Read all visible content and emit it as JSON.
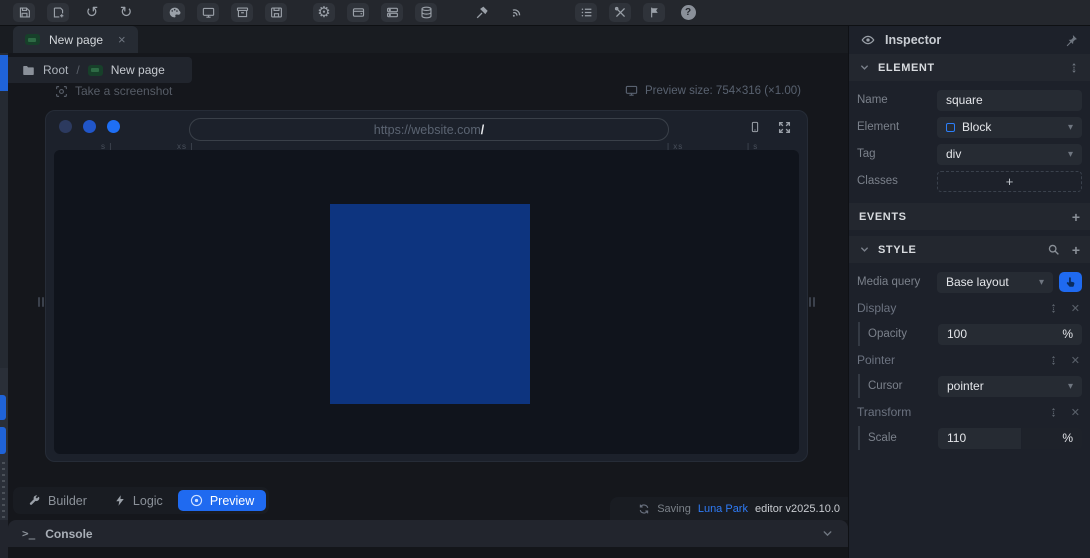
{
  "toolbar": {
    "icons": [
      "save",
      "save-add",
      "undo",
      "redo",
      "palette",
      "monitor",
      "archive",
      "drive",
      "settings",
      "wallet",
      "server",
      "database",
      "hammer",
      "signal",
      "list",
      "tools",
      "flag",
      "help"
    ],
    "undo_glyph": "↺",
    "redo_glyph": "↻",
    "gear_glyph": "⚙",
    "help_glyph": "?"
  },
  "tab": {
    "label": "New page",
    "close_glyph": "×"
  },
  "breadcrumb": {
    "root": "Root",
    "separator": "/",
    "current": "New page"
  },
  "actions": {
    "take_screenshot": "Take a screenshot"
  },
  "preview": {
    "size_label": "Preview size: 754×316 (×1.00)",
    "url": "https://website.com",
    "url_cursor": "/",
    "bp_left_s": "s |",
    "bp_left_xs": "xs |",
    "bp_right_xs": "| xs",
    "bp_right_s": "| s"
  },
  "mode_tabs": {
    "builder": "Builder",
    "logic": "Logic",
    "preview": "Preview"
  },
  "statusbar": {
    "saving": "Saving",
    "brand": "Luna Park",
    "version": "editor v2025.10.0"
  },
  "console": {
    "label": "Console",
    "prompt_glyph": ">_"
  },
  "inspector": {
    "title": "Inspector",
    "element": {
      "title": "ELEMENT",
      "name_label": "Name",
      "name_value": "square",
      "element_label": "Element",
      "element_value": "Block",
      "tag_label": "Tag",
      "tag_value": "div",
      "classes_label": "Classes",
      "classes_add": "+"
    },
    "events": {
      "title": "EVENTS",
      "add": "+"
    },
    "style": {
      "title": "STYLE",
      "add": "+",
      "media_query_label": "Media query",
      "media_query_value": "Base layout",
      "display_label": "Display",
      "opacity_label": "Opacity",
      "opacity_value": "100",
      "opacity_unit": "%",
      "pointer_label": "Pointer",
      "cursor_label": "Cursor",
      "cursor_value": "pointer",
      "transform_label": "Transform",
      "scale_label": "Scale",
      "scale_value": "110",
      "scale_unit": "%"
    },
    "caret_glyph": "▾",
    "remove_glyph": "✕"
  },
  "colors": {
    "accent": "#1f6af0",
    "preview_square": "#0d347f",
    "brand_link": "#2f7bf6",
    "tab_page_icon": "#17402a"
  }
}
